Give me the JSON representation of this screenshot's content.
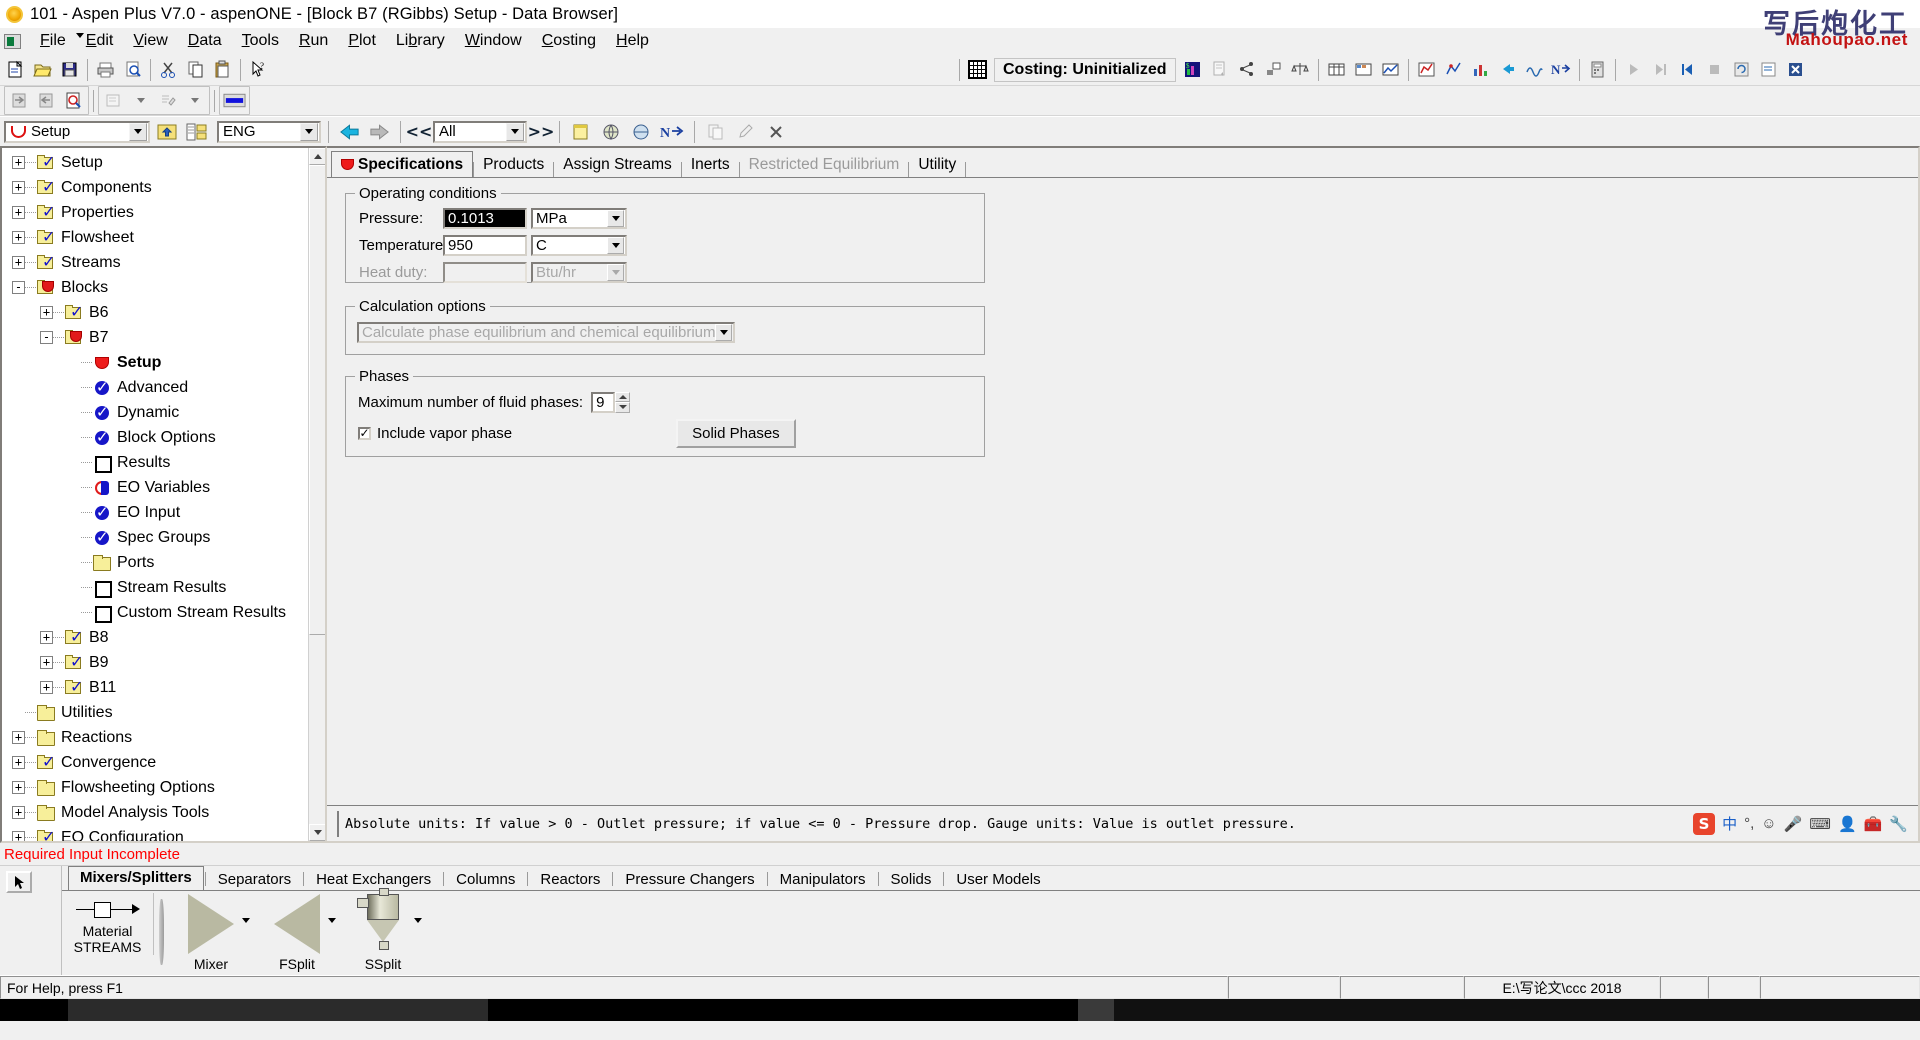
{
  "window": {
    "title": "101 - Aspen Plus V7.0 - aspenONE - [Block B7 (RGibbs) Setup - Data Browser]",
    "watermark_main": "写后炮化工",
    "watermark_sub": "Mahoupao.net"
  },
  "menu": {
    "items": [
      {
        "label": "File",
        "accel": "F"
      },
      {
        "label": "Edit",
        "accel": "E"
      },
      {
        "label": "View",
        "accel": "V"
      },
      {
        "label": "Data",
        "accel": "D"
      },
      {
        "label": "Tools",
        "accel": "T"
      },
      {
        "label": "Run",
        "accel": "R"
      },
      {
        "label": "Plot",
        "accel": "P"
      },
      {
        "label": "Library",
        "accel": "b"
      },
      {
        "label": "Window",
        "accel": "W"
      },
      {
        "label": "Costing",
        "accel": "C"
      },
      {
        "label": "Help",
        "accel": "H"
      }
    ]
  },
  "toolbar": {
    "costing_status": "Costing: Uninitialized",
    "icons": [
      "new-document-icon",
      "open-folder-icon",
      "save-icon",
      "print-icon",
      "print-preview-icon",
      "cut-icon",
      "copy-icon",
      "paste-icon",
      "help-pointer-icon"
    ],
    "right_icons": [
      "grid-icon",
      "costing-chart-icon",
      "report-icon",
      "share-icon",
      "window-icon",
      "balance-icon",
      "table-icon",
      "matrix-icon",
      "analysis-icon",
      "plot-icon",
      "histogram-icon",
      "chart2-icon",
      "back-arrow-icon",
      "wave-icon",
      "next-input-icon",
      "calculator-icon",
      "run-icon",
      "step-icon",
      "first-icon",
      "stop-icon",
      "reinit-icon",
      "results-icon",
      "close-x-icon"
    ]
  },
  "toolbar2": {
    "icons": [
      "move-in-icon",
      "move-out-icon",
      "search-doc-icon",
      "form-icon",
      "edit-form-icon",
      "blue-bar-icon"
    ]
  },
  "databrowser": {
    "form_select": "Setup",
    "form_select_icon": "red-cup-icon",
    "up-one-level": "up-folder-icon",
    "tree_toggle": "tree-toggle-icon",
    "units_select": "ENG",
    "back": "back-arrow-icon",
    "forward": "forward-arrow-icon",
    "prev": "<<",
    "scope_select": "All",
    "next": ">>",
    "icons": [
      "notes-icon",
      "globe-icon",
      "world-icon",
      "next-input-icon",
      "copy2-icon",
      "edit2-icon",
      "delete-x-icon"
    ]
  },
  "tree": {
    "items": [
      {
        "label": "Setup",
        "indent": 0,
        "expander": "+",
        "icon": "folder-check"
      },
      {
        "label": "Components",
        "indent": 0,
        "expander": "+",
        "icon": "folder-check"
      },
      {
        "label": "Properties",
        "indent": 0,
        "expander": "+",
        "icon": "folder-check"
      },
      {
        "label": "Flowsheet",
        "indent": 0,
        "expander": "+",
        "icon": "folder-check"
      },
      {
        "label": "Streams",
        "indent": 0,
        "expander": "+",
        "icon": "folder-check"
      },
      {
        "label": "Blocks",
        "indent": 0,
        "expander": "-",
        "icon": "folder-red"
      },
      {
        "label": "B6",
        "indent": 1,
        "expander": "+",
        "icon": "folder-check"
      },
      {
        "label": "B7",
        "indent": 1,
        "expander": "-",
        "icon": "folder-red"
      },
      {
        "label": "Setup",
        "indent": 2,
        "expander": "",
        "icon": "red-cup",
        "bold": true
      },
      {
        "label": "Advanced",
        "indent": 2,
        "expander": "",
        "icon": "blue-check"
      },
      {
        "label": "Dynamic",
        "indent": 2,
        "expander": "",
        "icon": "blue-check"
      },
      {
        "label": "Block Options",
        "indent": 2,
        "expander": "",
        "icon": "blue-check"
      },
      {
        "label": "Results",
        "indent": 2,
        "expander": "",
        "icon": "empty-square"
      },
      {
        "label": "EO Variables",
        "indent": 2,
        "expander": "",
        "icon": "half-red-blue"
      },
      {
        "label": "EO Input",
        "indent": 2,
        "expander": "",
        "icon": "blue-check"
      },
      {
        "label": "Spec Groups",
        "indent": 2,
        "expander": "",
        "icon": "blue-check"
      },
      {
        "label": "Ports",
        "indent": 2,
        "expander": "",
        "icon": "folder-plain"
      },
      {
        "label": "Stream Results",
        "indent": 2,
        "expander": "",
        "icon": "empty-square"
      },
      {
        "label": "Custom Stream Results",
        "indent": 2,
        "expander": "",
        "icon": "empty-square"
      },
      {
        "label": "B8",
        "indent": 1,
        "expander": "+",
        "icon": "folder-check"
      },
      {
        "label": "B9",
        "indent": 1,
        "expander": "+",
        "icon": "folder-check"
      },
      {
        "label": "B11",
        "indent": 1,
        "expander": "+",
        "icon": "folder-check"
      },
      {
        "label": "Utilities",
        "indent": 0,
        "expander": "",
        "icon": "folder-plain"
      },
      {
        "label": "Reactions",
        "indent": 0,
        "expander": "+",
        "icon": "folder-plain"
      },
      {
        "label": "Convergence",
        "indent": 0,
        "expander": "+",
        "icon": "folder-check"
      },
      {
        "label": "Flowsheeting Options",
        "indent": 0,
        "expander": "+",
        "icon": "folder-plain"
      },
      {
        "label": "Model Analysis Tools",
        "indent": 0,
        "expander": "+",
        "icon": "folder-plain"
      },
      {
        "label": "EO Configuration",
        "indent": 0,
        "expander": "+",
        "icon": "folder-check"
      }
    ]
  },
  "form": {
    "tabs": [
      {
        "label": "Specifications",
        "active": true,
        "disabled": false,
        "icon": "red-cup-icon"
      },
      {
        "label": "Products",
        "active": false,
        "disabled": false
      },
      {
        "label": "Assign Streams",
        "active": false,
        "disabled": false
      },
      {
        "label": "Inerts",
        "active": false,
        "disabled": false
      },
      {
        "label": "Restricted Equilibrium",
        "active": false,
        "disabled": true
      },
      {
        "label": "Utility",
        "active": false,
        "disabled": false
      }
    ],
    "operating_conditions": {
      "group_title": "Operating conditions",
      "pressure_label": "Pressure:",
      "pressure_value": "0.1013",
      "pressure_unit": "MPa",
      "pressure_selected": true,
      "temperature_label": "Temperature:",
      "temperature_value": "950",
      "temperature_unit": "C",
      "heat_duty_label": "Heat duty:",
      "heat_duty_value": "",
      "heat_duty_unit": "Btu/hr",
      "heat_duty_disabled": true
    },
    "calculation_options": {
      "group_title": "Calculation options",
      "selected": "Calculate phase equilibrium and chemical equilibrium",
      "disabled": true
    },
    "phases": {
      "group_title": "Phases",
      "max_fluid_phases_label": "Maximum number of fluid phases:",
      "max_fluid_phases_value": "9",
      "include_vapor_label": "Include vapor phase",
      "include_vapor_checked": true,
      "solid_phases_button": "Solid Phases"
    },
    "hint": "Absolute units: If value > 0 - Outlet pressure; if value <= 0 - Pressure drop.  Gauge units: Value is outlet pressure."
  },
  "ime": {
    "logo": "S",
    "mode": "中",
    "punct": "°,",
    "icons": [
      "emoji-icon",
      "mic-icon",
      "keyboard-icon",
      "user-icon",
      "toolbox-icon",
      "wrench-icon"
    ]
  },
  "status": {
    "required_input": "Required Input Incomplete",
    "help_text": "For Help, press F1",
    "path": "E:\\写论文\\ccc 2018"
  },
  "palette": {
    "tabs": [
      {
        "label": "Mixers/Splitters",
        "active": true
      },
      {
        "label": "Separators",
        "active": false
      },
      {
        "label": "Heat Exchangers",
        "active": false
      },
      {
        "label": "Columns",
        "active": false
      },
      {
        "label": "Reactors",
        "active": false
      },
      {
        "label": "Pressure Changers",
        "active": false
      },
      {
        "label": "Manipulators",
        "active": false
      },
      {
        "label": "Solids",
        "active": false
      },
      {
        "label": "User Models",
        "active": false
      }
    ],
    "streams": {
      "label": "Material",
      "group": "STREAMS"
    },
    "models": [
      {
        "label": "Mixer",
        "icon": "triangle-right-icon"
      },
      {
        "label": "FSplit",
        "icon": "triangle-left-icon"
      },
      {
        "label": "SSplit",
        "icon": "vessel-icon"
      }
    ]
  }
}
